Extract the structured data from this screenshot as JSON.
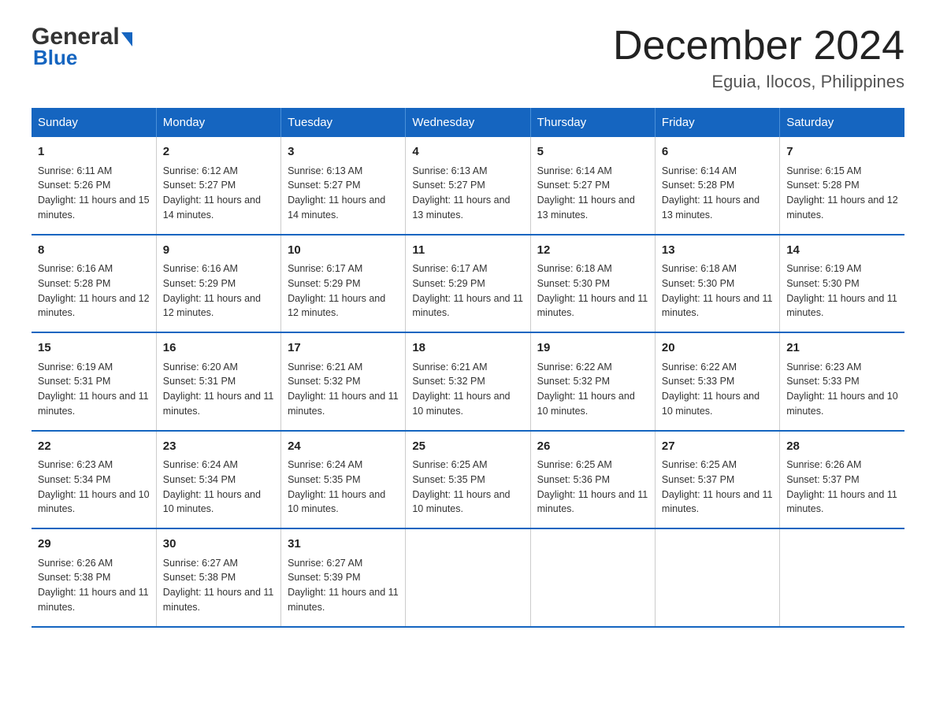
{
  "header": {
    "logo_general": "General",
    "logo_blue": "Blue",
    "month": "December 2024",
    "location": "Eguia, Ilocos, Philippines"
  },
  "days_of_week": [
    "Sunday",
    "Monday",
    "Tuesday",
    "Wednesday",
    "Thursday",
    "Friday",
    "Saturday"
  ],
  "weeks": [
    [
      {
        "day": "1",
        "sunrise": "6:11 AM",
        "sunset": "5:26 PM",
        "daylight": "11 hours and 15 minutes."
      },
      {
        "day": "2",
        "sunrise": "6:12 AM",
        "sunset": "5:27 PM",
        "daylight": "11 hours and 14 minutes."
      },
      {
        "day": "3",
        "sunrise": "6:13 AM",
        "sunset": "5:27 PM",
        "daylight": "11 hours and 14 minutes."
      },
      {
        "day": "4",
        "sunrise": "6:13 AM",
        "sunset": "5:27 PM",
        "daylight": "11 hours and 13 minutes."
      },
      {
        "day": "5",
        "sunrise": "6:14 AM",
        "sunset": "5:27 PM",
        "daylight": "11 hours and 13 minutes."
      },
      {
        "day": "6",
        "sunrise": "6:14 AM",
        "sunset": "5:28 PM",
        "daylight": "11 hours and 13 minutes."
      },
      {
        "day": "7",
        "sunrise": "6:15 AM",
        "sunset": "5:28 PM",
        "daylight": "11 hours and 12 minutes."
      }
    ],
    [
      {
        "day": "8",
        "sunrise": "6:16 AM",
        "sunset": "5:28 PM",
        "daylight": "11 hours and 12 minutes."
      },
      {
        "day": "9",
        "sunrise": "6:16 AM",
        "sunset": "5:29 PM",
        "daylight": "11 hours and 12 minutes."
      },
      {
        "day": "10",
        "sunrise": "6:17 AM",
        "sunset": "5:29 PM",
        "daylight": "11 hours and 12 minutes."
      },
      {
        "day": "11",
        "sunrise": "6:17 AM",
        "sunset": "5:29 PM",
        "daylight": "11 hours and 11 minutes."
      },
      {
        "day": "12",
        "sunrise": "6:18 AM",
        "sunset": "5:30 PM",
        "daylight": "11 hours and 11 minutes."
      },
      {
        "day": "13",
        "sunrise": "6:18 AM",
        "sunset": "5:30 PM",
        "daylight": "11 hours and 11 minutes."
      },
      {
        "day": "14",
        "sunrise": "6:19 AM",
        "sunset": "5:30 PM",
        "daylight": "11 hours and 11 minutes."
      }
    ],
    [
      {
        "day": "15",
        "sunrise": "6:19 AM",
        "sunset": "5:31 PM",
        "daylight": "11 hours and 11 minutes."
      },
      {
        "day": "16",
        "sunrise": "6:20 AM",
        "sunset": "5:31 PM",
        "daylight": "11 hours and 11 minutes."
      },
      {
        "day": "17",
        "sunrise": "6:21 AM",
        "sunset": "5:32 PM",
        "daylight": "11 hours and 11 minutes."
      },
      {
        "day": "18",
        "sunrise": "6:21 AM",
        "sunset": "5:32 PM",
        "daylight": "11 hours and 10 minutes."
      },
      {
        "day": "19",
        "sunrise": "6:22 AM",
        "sunset": "5:32 PM",
        "daylight": "11 hours and 10 minutes."
      },
      {
        "day": "20",
        "sunrise": "6:22 AM",
        "sunset": "5:33 PM",
        "daylight": "11 hours and 10 minutes."
      },
      {
        "day": "21",
        "sunrise": "6:23 AM",
        "sunset": "5:33 PM",
        "daylight": "11 hours and 10 minutes."
      }
    ],
    [
      {
        "day": "22",
        "sunrise": "6:23 AM",
        "sunset": "5:34 PM",
        "daylight": "11 hours and 10 minutes."
      },
      {
        "day": "23",
        "sunrise": "6:24 AM",
        "sunset": "5:34 PM",
        "daylight": "11 hours and 10 minutes."
      },
      {
        "day": "24",
        "sunrise": "6:24 AM",
        "sunset": "5:35 PM",
        "daylight": "11 hours and 10 minutes."
      },
      {
        "day": "25",
        "sunrise": "6:25 AM",
        "sunset": "5:35 PM",
        "daylight": "11 hours and 10 minutes."
      },
      {
        "day": "26",
        "sunrise": "6:25 AM",
        "sunset": "5:36 PM",
        "daylight": "11 hours and 11 minutes."
      },
      {
        "day": "27",
        "sunrise": "6:25 AM",
        "sunset": "5:37 PM",
        "daylight": "11 hours and 11 minutes."
      },
      {
        "day": "28",
        "sunrise": "6:26 AM",
        "sunset": "5:37 PM",
        "daylight": "11 hours and 11 minutes."
      }
    ],
    [
      {
        "day": "29",
        "sunrise": "6:26 AM",
        "sunset": "5:38 PM",
        "daylight": "11 hours and 11 minutes."
      },
      {
        "day": "30",
        "sunrise": "6:27 AM",
        "sunset": "5:38 PM",
        "daylight": "11 hours and 11 minutes."
      },
      {
        "day": "31",
        "sunrise": "6:27 AM",
        "sunset": "5:39 PM",
        "daylight": "11 hours and 11 minutes."
      },
      null,
      null,
      null,
      null
    ]
  ]
}
